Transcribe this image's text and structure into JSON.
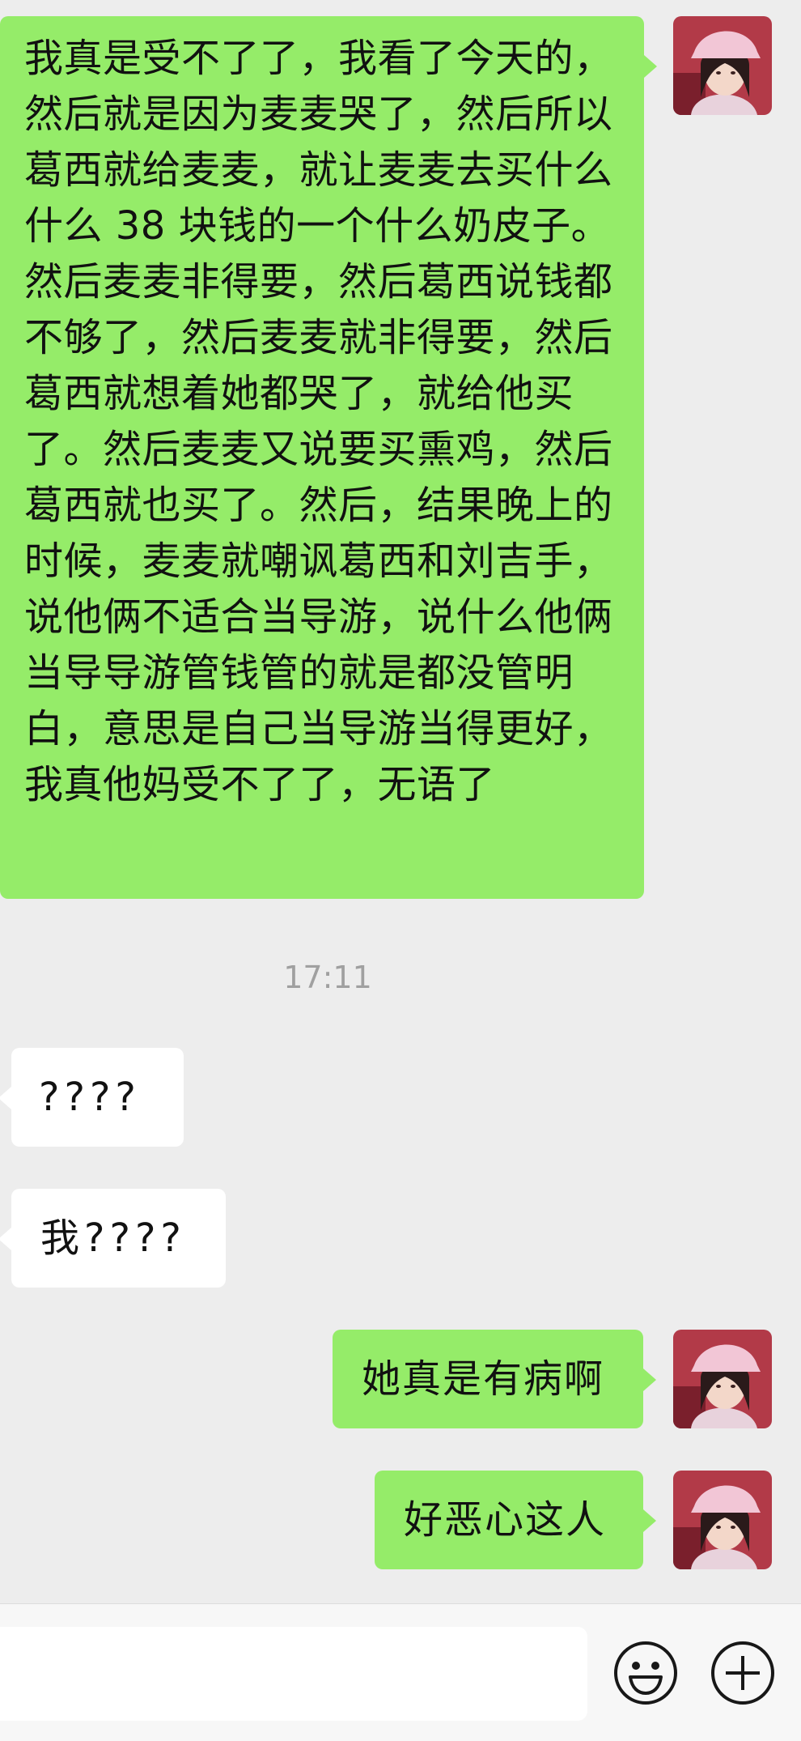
{
  "messages": {
    "long": "我真是受不了了，我看了今天的，然后就是因为麦麦哭了，然后所以葛西就给麦麦，就让麦麦去买什么什么 38 块钱的一个什么奶皮子。然后麦麦非得要，然后葛西说钱都不够了，然后麦麦就非得要，然后葛西就想着她都哭了，就给他买了。然后麦麦又说要买熏鸡，然后葛西就也买了。然后，结果晚上的时候，麦麦就嘲讽葛西和刘吉手，说他俩不适合当导游，说什么他俩当导导游管钱管的就是都没管明白，意思是自己当导游当得更好，我真他妈受不了了，无语了",
    "timestamp": "17:11",
    "q1": "????",
    "q2": "我????",
    "sick": "她真是有病啊",
    "gross": "好恶心这人"
  },
  "input": {
    "value": "",
    "placeholder": ""
  },
  "icons": {
    "emoji": "smiley-face-icon",
    "plus": "plus-circle-icon",
    "avatar": "user-avatar-photo"
  },
  "colors": {
    "background": "#ededed",
    "sent_bubble": "#95ec69",
    "received_bubble": "#ffffff",
    "timestamp": "#a0a0a0"
  }
}
